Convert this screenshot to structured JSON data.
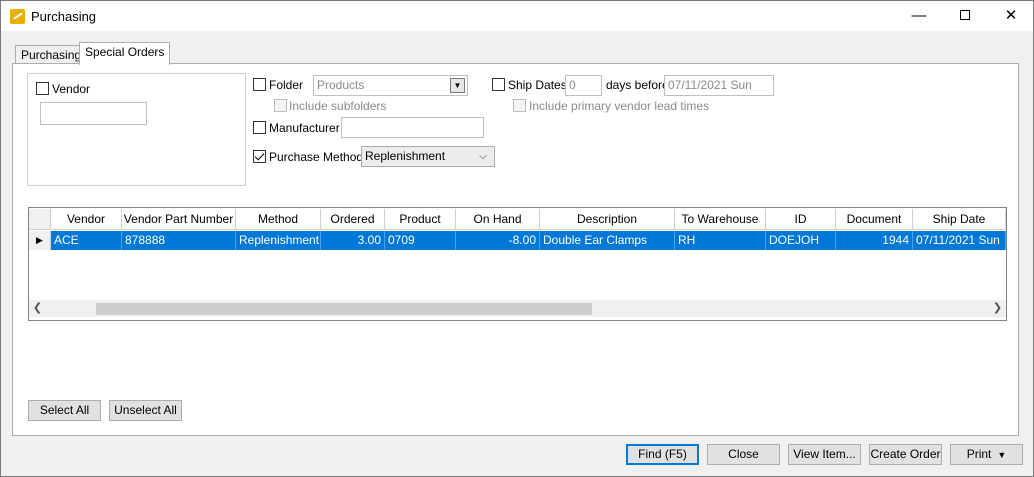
{
  "window": {
    "title": "Purchasing",
    "minimize": "—",
    "close": "✕"
  },
  "tabs": [
    "Purchasing",
    "Special Orders"
  ],
  "filters": {
    "vendor_label": "Vendor",
    "vendor_value": "",
    "folder_label": "Folder",
    "folder_value": "Products",
    "include_subfolders_label": "Include subfolders",
    "manufacturer_label": "Manufacturer",
    "manufacturer_value": "",
    "purchase_method_label": "Purchase Method",
    "purchase_method_value": "Replenishment",
    "ship_dates_label": "Ship Dates",
    "ship_days_value": "0",
    "days_before_label": "days before",
    "ship_date_value": "07/11/2021 Sun",
    "include_lead_times_label": "Include primary vendor lead times"
  },
  "grid": {
    "columns": [
      "Vendor",
      "Vendor Part Number",
      "Method",
      "Ordered",
      "Product",
      "On Hand",
      "Description",
      "To Warehouse",
      "ID",
      "Document",
      "Ship Date"
    ],
    "rows": [
      [
        "ACE",
        "878888",
        "Replenishment",
        "3.00",
        "0709",
        "-8.00",
        "Double Ear Clamps",
        "RH",
        "DOEJOH",
        "1944",
        "07/11/2021 Sun"
      ]
    ]
  },
  "buttons": {
    "select_all": "Select All",
    "unselect_all": "Unselect All",
    "find": "Find (F5)",
    "close": "Close",
    "view_item": "View Item...",
    "create_order": "Create Order",
    "print": "Print"
  },
  "icons": {
    "app": "purchasing-app-icon",
    "folder_drop": "dropdown-arrow-icon",
    "method_drop": "chevron-down-icon",
    "row_indicator": "current-row-arrow-icon",
    "scroll_left": "scroll-left-icon",
    "scroll_right": "scroll-right-icon"
  },
  "colors": {
    "selection": "#0078d7",
    "default_button_border": "#0078d7"
  }
}
